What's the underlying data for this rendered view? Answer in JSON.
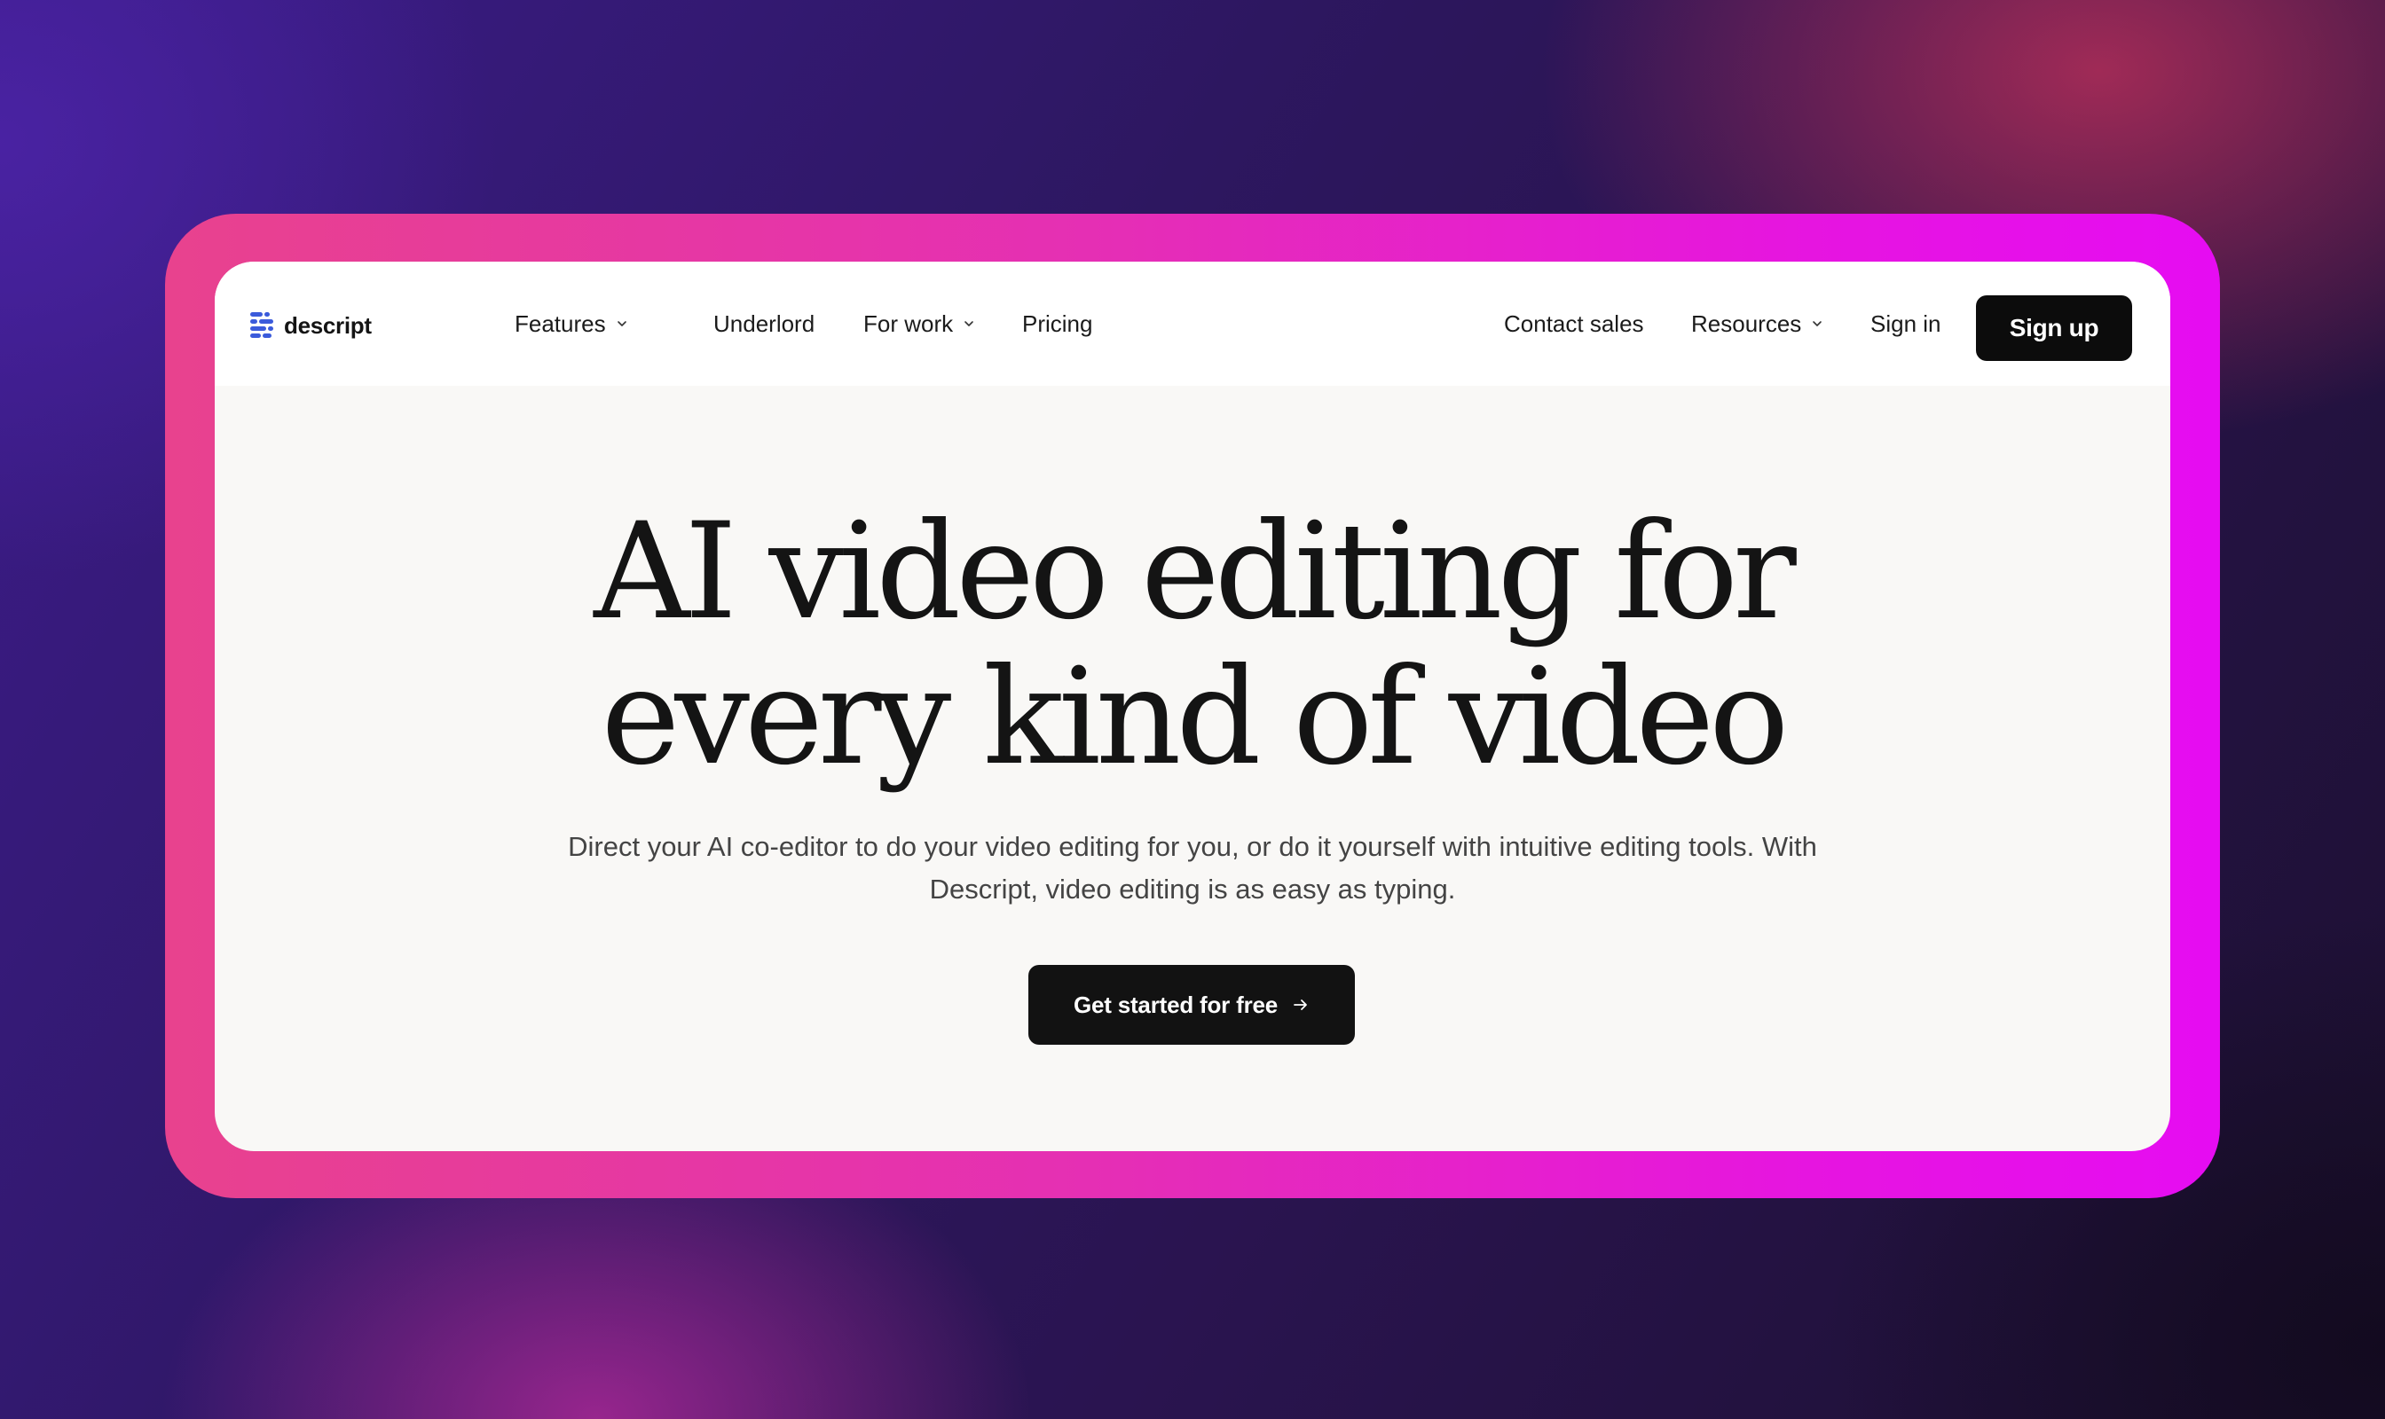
{
  "brand": {
    "name": "descript",
    "logo_icon": "descript-logo-icon",
    "logo_color": "#3b5bdb"
  },
  "nav": {
    "left": [
      {
        "label": "Features",
        "has_dropdown": true
      },
      {
        "label": "Underlord",
        "has_dropdown": false
      },
      {
        "label": "For work",
        "has_dropdown": true
      },
      {
        "label": "Pricing",
        "has_dropdown": false
      }
    ],
    "right": [
      {
        "label": "Contact sales",
        "has_dropdown": false
      },
      {
        "label": "Resources",
        "has_dropdown": true
      },
      {
        "label": "Sign in",
        "has_dropdown": false
      }
    ],
    "signup_label": "Sign up",
    "dropdown_icon": "chevron-down-icon"
  },
  "hero": {
    "title_line1": "AI video editing for",
    "title_line2": "every kind of video",
    "subtitle": "Direct your AI co-editor to do your video editing for you, or do it yourself with intuitive editing tools. With Descript, video editing is as easy as typing.",
    "cta_label": "Get started for free",
    "cta_icon": "arrow-right-icon"
  },
  "colors": {
    "frame_gradient_start": "#e8428e",
    "frame_gradient_end": "#e60cf2",
    "button_bg": "#0c0c0c",
    "card_bg": "#f9f8f6"
  }
}
